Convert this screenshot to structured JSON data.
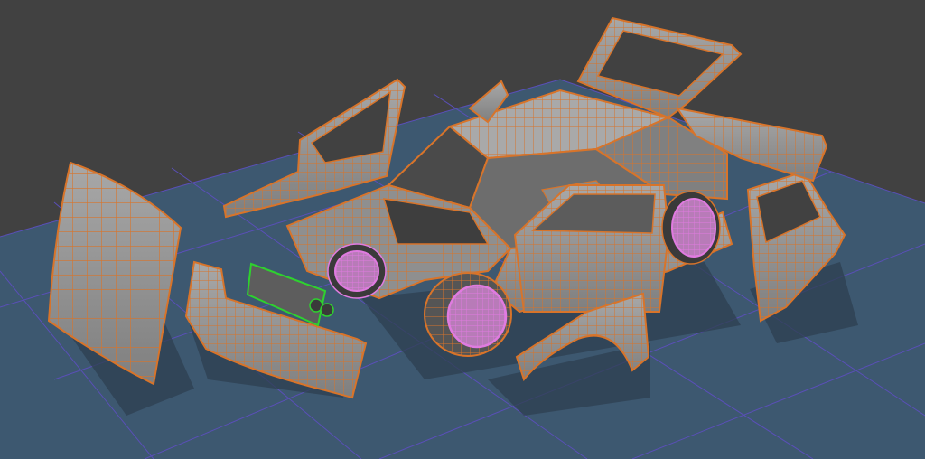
{
  "viewport": {
    "background_color": "#414141",
    "grid_plane_color": "#3d5870",
    "grid_line_color": "#5a4fb8",
    "wire_color": "#d8742a",
    "surface_color": "#9a9a9a",
    "wheel_wire_color": "#e07be0",
    "light_wire_color": "#2fd12f"
  }
}
